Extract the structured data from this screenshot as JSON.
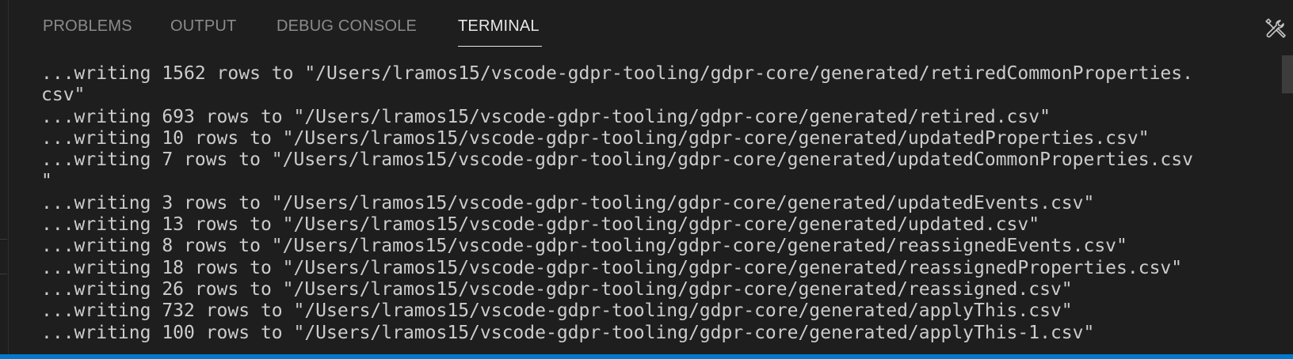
{
  "tabs": [
    {
      "label": "PROBLEMS"
    },
    {
      "label": "OUTPUT"
    },
    {
      "label": "DEBUG CONSOLE"
    },
    {
      "label": "TERMINAL"
    }
  ],
  "active_tab": "TERMINAL",
  "icons": {
    "tools": "tools-icon"
  },
  "colors": {
    "background": "#1e1e1e",
    "tab_inactive": "#8b8b8b",
    "tab_active": "#e7e7e7",
    "terminal_text": "#cccccc",
    "status_bar": "#007acc"
  },
  "terminal": {
    "lines": [
      "...writing 1562 rows to \"/Users/lramos15/vscode-gdpr-tooling/gdpr-core/generated/retiredCommonProperties.",
      "csv\"",
      "...writing 693 rows to \"/Users/lramos15/vscode-gdpr-tooling/gdpr-core/generated/retired.csv\"",
      "...writing 10 rows to \"/Users/lramos15/vscode-gdpr-tooling/gdpr-core/generated/updatedProperties.csv\"",
      "...writing 7 rows to \"/Users/lramos15/vscode-gdpr-tooling/gdpr-core/generated/updatedCommonProperties.csv",
      "\"",
      "...writing 3 rows to \"/Users/lramos15/vscode-gdpr-tooling/gdpr-core/generated/updatedEvents.csv\"",
      "...writing 13 rows to \"/Users/lramos15/vscode-gdpr-tooling/gdpr-core/generated/updated.csv\"",
      "...writing 8 rows to \"/Users/lramos15/vscode-gdpr-tooling/gdpr-core/generated/reassignedEvents.csv\"",
      "...writing 18 rows to \"/Users/lramos15/vscode-gdpr-tooling/gdpr-core/generated/reassignedProperties.csv\"",
      "...writing 26 rows to \"/Users/lramos15/vscode-gdpr-tooling/gdpr-core/generated/reassigned.csv\"",
      "...writing 732 rows to \"/Users/lramos15/vscode-gdpr-tooling/gdpr-core/generated/applyThis.csv\"",
      "...writing 100 rows to \"/Users/lramos15/vscode-gdpr-tooling/gdpr-core/generated/applyThis-1.csv\""
    ]
  }
}
